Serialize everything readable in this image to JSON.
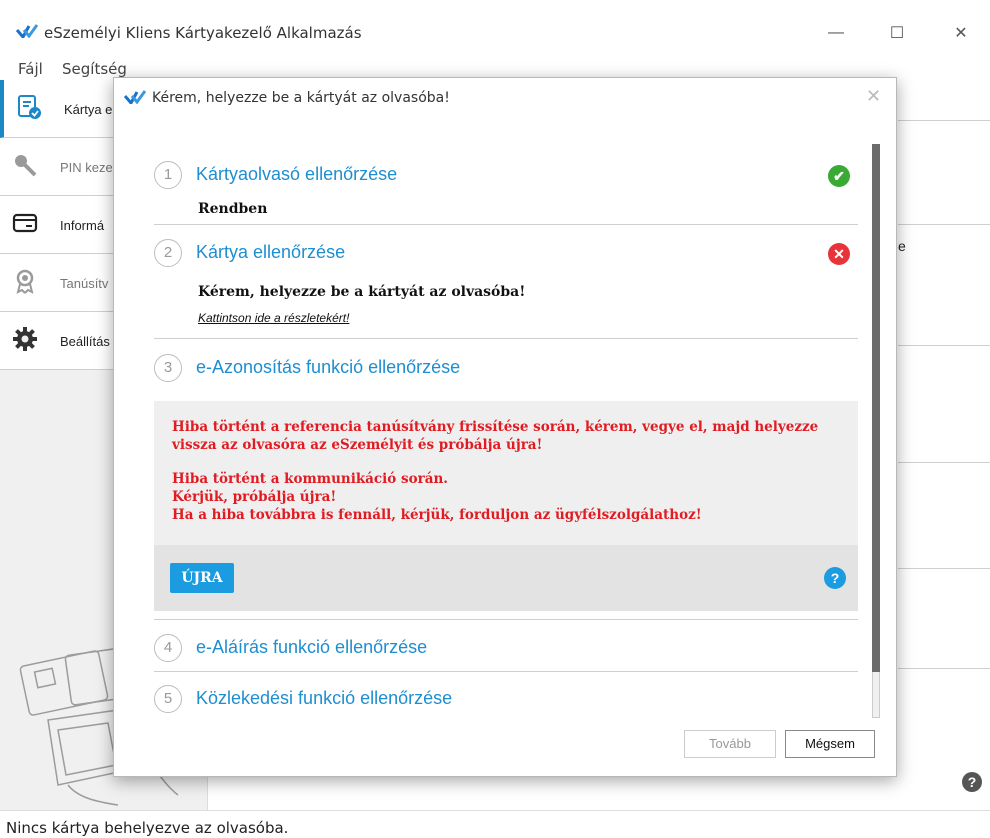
{
  "window": {
    "title": "eSzemélyi Kliens Kártyakezelő Alkalmazás",
    "min_icon": "—",
    "max_icon": "☐",
    "close_icon": "✕"
  },
  "menu": {
    "file": "Fájl",
    "help": "Segítség"
  },
  "sidebar": {
    "items": [
      {
        "label": "Kártya e",
        "icon": "card-check-icon"
      },
      {
        "label": "PIN keze",
        "icon": "key-icon"
      },
      {
        "label": "Informá",
        "icon": "card-icon"
      },
      {
        "label": "Tanúsítv",
        "icon": "certificate-icon"
      },
      {
        "label": "Beállítás",
        "icon": "gear-icon"
      }
    ]
  },
  "background": {
    "partial_text": "e",
    "help_icon": "?"
  },
  "status": {
    "text": "Nincs kártya behelyezve az olvasóba."
  },
  "dialog": {
    "title": "Kérem, helyezze be a kártyát az olvasóba!",
    "close_icon": "✕",
    "steps": [
      {
        "num": "1",
        "title": "Kártyaolvasó ellenőrzése",
        "status": "ok",
        "status_icon": "✔",
        "sub": "Rendben"
      },
      {
        "num": "2",
        "title": "Kártya ellenőrzése",
        "status": "error",
        "status_icon": "✕",
        "sub": "Kérem, helyezze be a kártyát az olvasóba!",
        "link": "Kattintson ide a részletekért!"
      },
      {
        "num": "3",
        "title": "e-Azonosítás funkció ellenőrzése"
      },
      {
        "num": "4",
        "title": "e-Aláírás funkció ellenőrzése"
      },
      {
        "num": "5",
        "title": "Közlekedési funkció ellenőrzése"
      }
    ],
    "error": {
      "line1": "Hiba történt a referencia tanúsítvány frissítése során, kérem, vegye el, majd helyezze",
      "line2": "vissza az olvasóra az eSzemélyit és próbálja újra!",
      "line3": "Hiba történt a kommunikáció során.",
      "line4": "Kérjük, próbálja újra!",
      "line5": "Ha a hiba továbbra is fennáll, kérjük, forduljon az ügyfélszolgálathoz!",
      "retry_label": "ÚJRA",
      "help_icon": "?"
    },
    "buttons": {
      "next": "Tovább",
      "cancel": "Mégsem"
    }
  },
  "colors": {
    "accent": "#1d8ed1",
    "error": "#e11b22",
    "ok": "#3aaa35"
  }
}
